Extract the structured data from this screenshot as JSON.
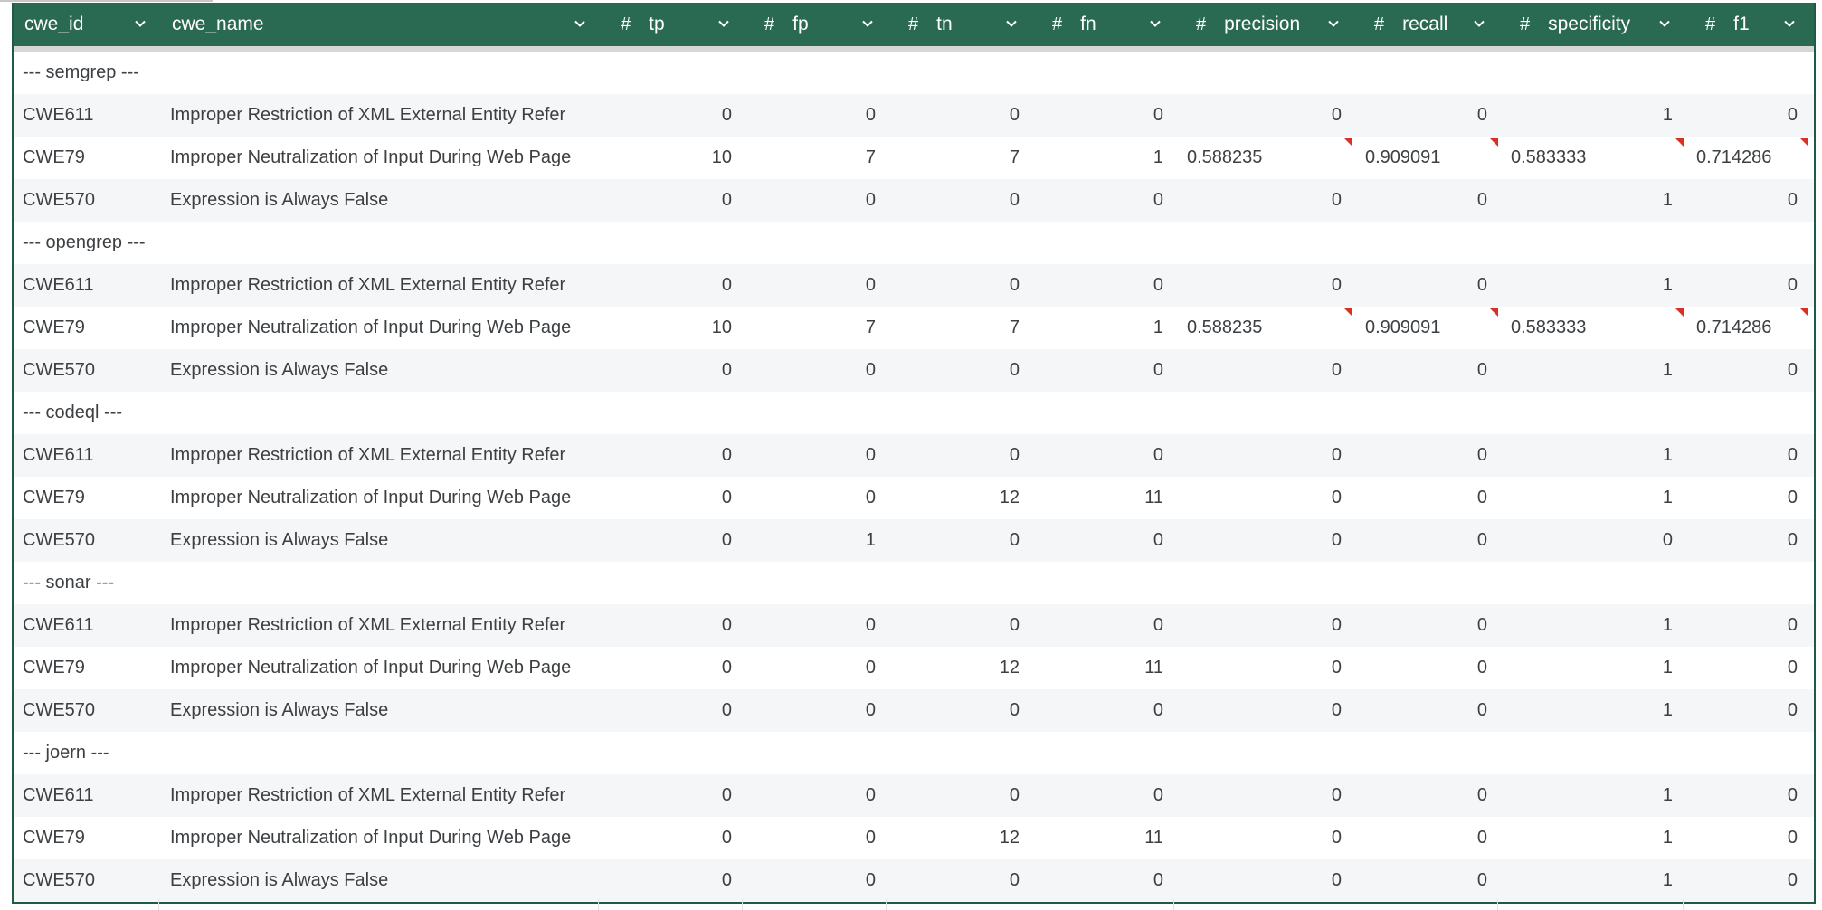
{
  "columns": [
    {
      "label": "cwe_id",
      "numeric": false
    },
    {
      "label": "cwe_name",
      "numeric": false
    },
    {
      "label": "tp",
      "numeric": true
    },
    {
      "label": "fp",
      "numeric": true
    },
    {
      "label": "tn",
      "numeric": true
    },
    {
      "label": "fn",
      "numeric": true
    },
    {
      "label": "precision",
      "numeric": true
    },
    {
      "label": "recall",
      "numeric": true
    },
    {
      "label": "specificity",
      "numeric": true
    },
    {
      "label": "f1",
      "numeric": true
    }
  ],
  "hash_symbol": "#",
  "colors": {
    "header_bg": "#2a6a52",
    "border": "#1e5b46",
    "flag": "#d93025",
    "row_alt": "#f5f6f8"
  },
  "groups": [
    {
      "label": "--- semgrep ---",
      "rows": [
        [
          "CWE611",
          "Improper Restriction of XML External Entity Refer",
          "0",
          "0",
          "0",
          "0",
          "0",
          "0",
          "1",
          "0"
        ],
        [
          "CWE79",
          "Improper Neutralization of Input During Web Page",
          "10",
          "7",
          "7",
          "1",
          "0.588235",
          "0.909091",
          "0.583333",
          "0.714286"
        ],
        [
          "CWE570",
          "Expression is Always False",
          "0",
          "0",
          "0",
          "0",
          "0",
          "0",
          "1",
          "0"
        ]
      ]
    },
    {
      "label": "--- opengrep ---",
      "rows": [
        [
          "CWE611",
          "Improper Restriction of XML External Entity Refer",
          "0",
          "0",
          "0",
          "0",
          "0",
          "0",
          "1",
          "0"
        ],
        [
          "CWE79",
          "Improper Neutralization of Input During Web Page",
          "10",
          "7",
          "7",
          "1",
          "0.588235",
          "0.909091",
          "0.583333",
          "0.714286"
        ],
        [
          "CWE570",
          "Expression is Always False",
          "0",
          "0",
          "0",
          "0",
          "0",
          "0",
          "1",
          "0"
        ]
      ]
    },
    {
      "label": "--- codeql ---",
      "rows": [
        [
          "CWE611",
          "Improper Restriction of XML External Entity Refer",
          "0",
          "0",
          "0",
          "0",
          "0",
          "0",
          "1",
          "0"
        ],
        [
          "CWE79",
          "Improper Neutralization of Input During Web Page",
          "0",
          "0",
          "12",
          "11",
          "0",
          "0",
          "1",
          "0"
        ],
        [
          "CWE570",
          "Expression is Always False",
          "0",
          "1",
          "0",
          "0",
          "0",
          "0",
          "0",
          "0"
        ]
      ]
    },
    {
      "label": "--- sonar ---",
      "rows": [
        [
          "CWE611",
          "Improper Restriction of XML External Entity Refer",
          "0",
          "0",
          "0",
          "0",
          "0",
          "0",
          "1",
          "0"
        ],
        [
          "CWE79",
          "Improper Neutralization of Input During Web Page",
          "0",
          "0",
          "12",
          "11",
          "0",
          "0",
          "1",
          "0"
        ],
        [
          "CWE570",
          "Expression is Always False",
          "0",
          "0",
          "0",
          "0",
          "0",
          "0",
          "1",
          "0"
        ]
      ]
    },
    {
      "label": "--- joern ---",
      "rows": [
        [
          "CWE611",
          "Improper Restriction of XML External Entity Refer",
          "0",
          "0",
          "0",
          "0",
          "0",
          "0",
          "1",
          "0"
        ],
        [
          "CWE79",
          "Improper Neutralization of Input During Web Page",
          "0",
          "0",
          "12",
          "11",
          "0",
          "0",
          "1",
          "0"
        ],
        [
          "CWE570",
          "Expression is Always False",
          "0",
          "0",
          "0",
          "0",
          "0",
          "0",
          "1",
          "0"
        ]
      ]
    }
  ]
}
